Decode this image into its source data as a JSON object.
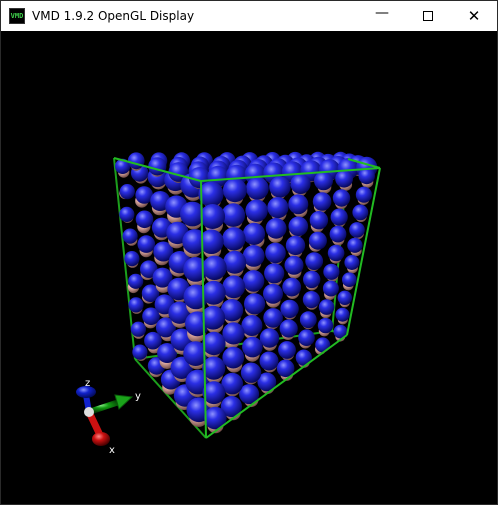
{
  "window": {
    "title": "VMD 1.9.2 OpenGL Display",
    "icon_text": "VMD",
    "icon": "vmd-app-icon",
    "controls": {
      "minimize_symbol": "—",
      "maximize_icon": "maximize-icon",
      "close_symbol": "✕"
    }
  },
  "scene": {
    "background_color": "#000000",
    "representation": "VDW",
    "atom_colors": {
      "large": "#2326d9",
      "small": "#e8b2aa"
    },
    "box_color": "#22bb22",
    "axes": {
      "x_label": "x",
      "y_label": "y",
      "z_label": "z",
      "x_color": "#cc1111",
      "y_color": "#119911",
      "z_color": "#1122cc"
    }
  }
}
